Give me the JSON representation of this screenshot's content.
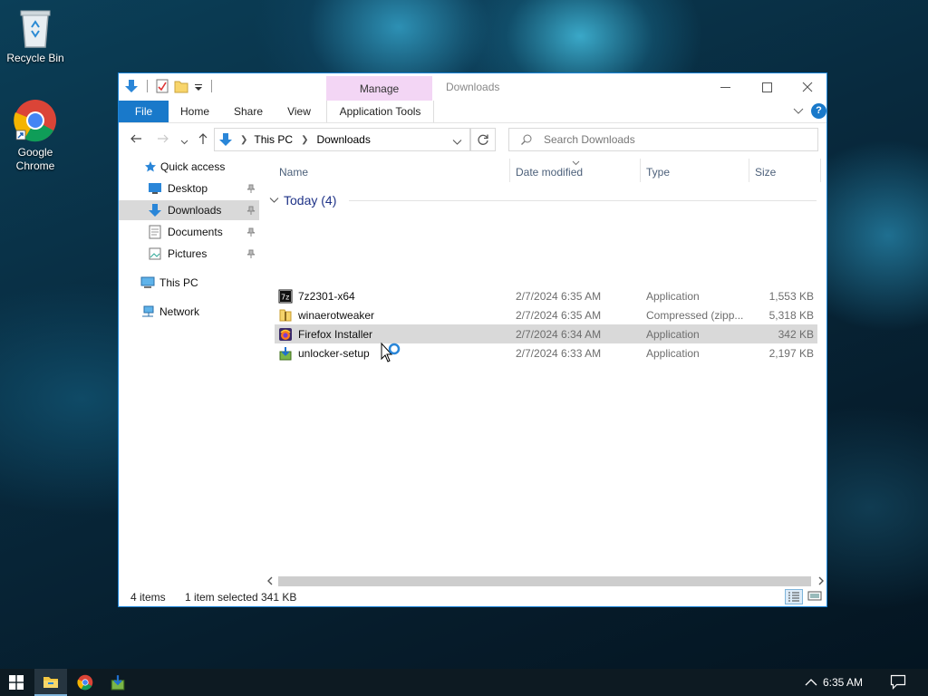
{
  "desktop": {
    "icons": [
      {
        "label": "Recycle Bin"
      },
      {
        "label": "Google Chrome"
      }
    ]
  },
  "window": {
    "title": "Downloads",
    "manage_tab": "Manage",
    "ribbon_tabs": {
      "file": "File",
      "home": "Home",
      "share": "Share",
      "view": "View",
      "app_tools": "Application Tools"
    },
    "address": {
      "crumbs": [
        "This PC",
        "Downloads"
      ]
    },
    "search": {
      "placeholder": "Search Downloads"
    },
    "nav": {
      "quick_access": "Quick access",
      "desktop": "Desktop",
      "downloads": "Downloads",
      "documents": "Documents",
      "pictures": "Pictures",
      "this_pc": "This PC",
      "network": "Network"
    },
    "columns": {
      "name": "Name",
      "date": "Date modified",
      "type": "Type",
      "size": "Size"
    },
    "group": {
      "label": "Today (4)"
    },
    "files": [
      {
        "name": "7z2301-x64",
        "date": "2/7/2024 6:35 AM",
        "type": "Application",
        "size": "1,553 KB"
      },
      {
        "name": "winaerotweaker",
        "date": "2/7/2024 6:35 AM",
        "type": "Compressed (zipp...",
        "size": "5,318 KB"
      },
      {
        "name": "Firefox Installer",
        "date": "2/7/2024 6:34 AM",
        "type": "Application",
        "size": "342 KB"
      },
      {
        "name": "unlocker-setup",
        "date": "2/7/2024 6:33 AM",
        "type": "Application",
        "size": "2,197 KB"
      }
    ],
    "status": {
      "count": "4 items",
      "selected": "1 item selected",
      "size": "341 KB"
    }
  },
  "taskbar": {
    "time": "6:35 AM"
  },
  "colors": {
    "accent": "#1979ca",
    "manage_tab": "#f3d6f5",
    "selection": "#d9d9d9"
  }
}
